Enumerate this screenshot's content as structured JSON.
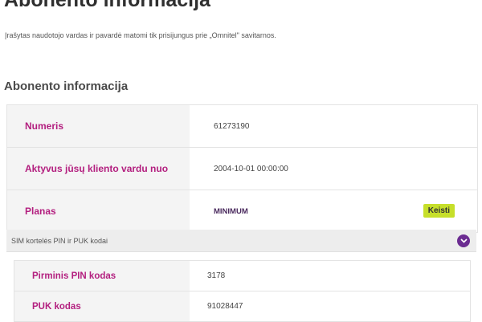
{
  "page": {
    "title": "Abonento informacija",
    "intro": "Įrašytas naudotojo vardas ir pavardė matomi tik prisijungus prie „Omnitel\" savitarnos."
  },
  "section": {
    "title": "Abonento informacija",
    "rows": [
      {
        "label": "Numeris",
        "value": "61273190"
      },
      {
        "label": "Aktyvus jūsų kliento vardu nuo",
        "value": "2004-10-01 00:00:00"
      },
      {
        "label": "Planas",
        "value": "MINIMUM",
        "button": "Keisti"
      }
    ]
  },
  "sim": {
    "header": "SIM kortelės PIN ir PUK kodai",
    "toggle_icon": "chevron-down-icon",
    "rows": [
      {
        "label": "Pirminis PIN kodas",
        "value": "3178"
      },
      {
        "label": "PUK kodas",
        "value": "91028447"
      }
    ]
  },
  "colors": {
    "label_accent": "#b31f7f",
    "button_bg": "#c6df2a",
    "toggle_bg": "#6b2c91"
  }
}
